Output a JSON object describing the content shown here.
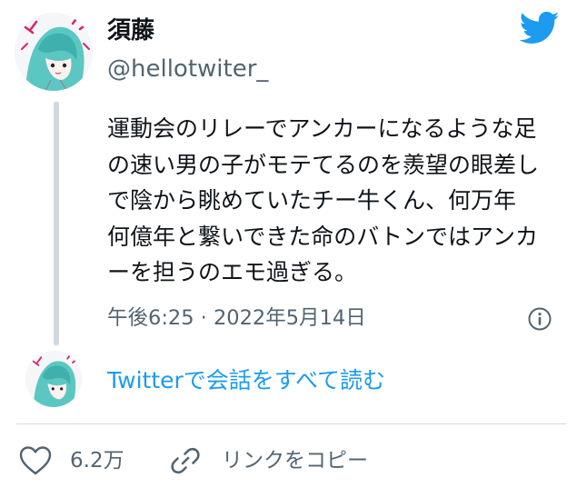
{
  "author": {
    "name": "須藤",
    "handle": "@hellotwiter_"
  },
  "tweet": {
    "text": "運動会のリレーでアンカーになるような足\nの速い男の子がモテてるのを羨望の眼差し\nで陰から眺めていたチー牛くん、何万年\n何億年と繋いできた命のバトンではアンカ\nーを担うのエモ過ぎる。",
    "timestamp": "午後6:25 · 2022年5月14日"
  },
  "conversation": {
    "read_all_label": "Twitterで会話をすべて読む"
  },
  "actions": {
    "like_count": "6.2万",
    "copy_link_label": "リンクをコピー"
  },
  "colors": {
    "twitter_blue": "#1d9bf0",
    "secondary_text": "#536471",
    "divider": "#cfd9de"
  },
  "icons": {
    "brand": "twitter-bird-icon",
    "info": "info-icon",
    "like": "heart-icon",
    "link": "link-icon"
  }
}
